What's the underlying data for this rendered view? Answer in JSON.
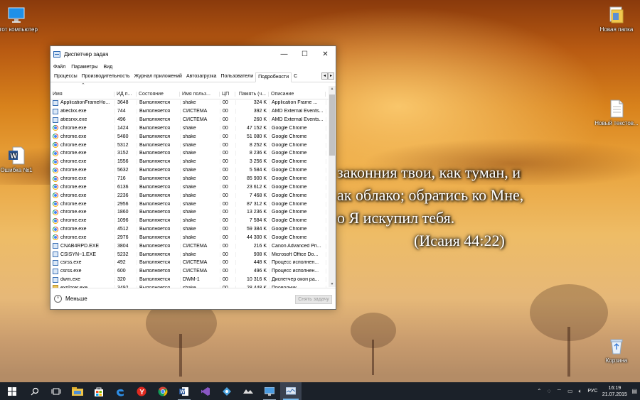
{
  "desktop": {
    "icons": [
      {
        "label": "Этот компьютер"
      },
      {
        "label": "Новая папка"
      },
      {
        "label": "Новый текстов..."
      },
      {
        "label": "Ошибка №1"
      },
      {
        "label": "Корзина"
      }
    ],
    "verse_lines": [
      "законния твои, как туман, и",
      "ак облако; обратись ко Мне,",
      "о Я искупил тебя.",
      "(Исаия 44:22)"
    ]
  },
  "task_manager": {
    "title": "Диспетчер задач",
    "window_buttons": {
      "minimize": "—",
      "maximize": "☐",
      "close": "✕"
    },
    "menu": [
      "Файл",
      "Параметры",
      "Вид"
    ],
    "tabs": [
      "Процессы",
      "Производительность",
      "Журнал приложений",
      "Автозагрузка",
      "Пользователи",
      "Подробности",
      "С"
    ],
    "active_tab": "Подробности",
    "columns": [
      "Имя",
      "ИД п...",
      "Состояние",
      "Имя польз...",
      "ЦП",
      "Память (ч...",
      "Описание"
    ],
    "rows": [
      {
        "icon": "exe",
        "name": "ApplicationFrameHo...",
        "pid": "3648",
        "status": "Выполняется",
        "user": "shake",
        "cpu": "00",
        "mem": "324 K",
        "desc": "Application Frame ..."
      },
      {
        "icon": "exe",
        "name": "atieclxx.exe",
        "pid": "744",
        "status": "Выполняется",
        "user": "СИСТЕМА",
        "cpu": "00",
        "mem": "392 K",
        "desc": "AMD External Events..."
      },
      {
        "icon": "exe",
        "name": "atiesrxx.exe",
        "pid": "496",
        "status": "Выполняется",
        "user": "СИСТЕМА",
        "cpu": "00",
        "mem": "260 K",
        "desc": "AMD External Events..."
      },
      {
        "icon": "chrome",
        "name": "chrome.exe",
        "pid": "1424",
        "status": "Выполняется",
        "user": "shake",
        "cpu": "00",
        "mem": "47 152 K",
        "desc": "Google Chrome"
      },
      {
        "icon": "chrome",
        "name": "chrome.exe",
        "pid": "5480",
        "status": "Выполняется",
        "user": "shake",
        "cpu": "00",
        "mem": "51 080 K",
        "desc": "Google Chrome"
      },
      {
        "icon": "chrome",
        "name": "chrome.exe",
        "pid": "5312",
        "status": "Выполняется",
        "user": "shake",
        "cpu": "00",
        "mem": "8 252 K",
        "desc": "Google Chrome"
      },
      {
        "icon": "chrome",
        "name": "chrome.exe",
        "pid": "3152",
        "status": "Выполняется",
        "user": "shake",
        "cpu": "00",
        "mem": "8 236 K",
        "desc": "Google Chrome"
      },
      {
        "icon": "chrome",
        "name": "chrome.exe",
        "pid": "1556",
        "status": "Выполняется",
        "user": "shake",
        "cpu": "00",
        "mem": "3 256 K",
        "desc": "Google Chrome"
      },
      {
        "icon": "chrome",
        "name": "chrome.exe",
        "pid": "5632",
        "status": "Выполняется",
        "user": "shake",
        "cpu": "00",
        "mem": "5 584 K",
        "desc": "Google Chrome"
      },
      {
        "icon": "chrome",
        "name": "chrome.exe",
        "pid": "716",
        "status": "Выполняется",
        "user": "shake",
        "cpu": "00",
        "mem": "85 900 K",
        "desc": "Google Chrome"
      },
      {
        "icon": "chrome",
        "name": "chrome.exe",
        "pid": "6136",
        "status": "Выполняется",
        "user": "shake",
        "cpu": "00",
        "mem": "23 612 K",
        "desc": "Google Chrome"
      },
      {
        "icon": "chrome",
        "name": "chrome.exe",
        "pid": "2236",
        "status": "Выполняется",
        "user": "shake",
        "cpu": "00",
        "mem": "7 468 K",
        "desc": "Google Chrome"
      },
      {
        "icon": "chrome",
        "name": "chrome.exe",
        "pid": "2956",
        "status": "Выполняется",
        "user": "shake",
        "cpu": "00",
        "mem": "87 312 K",
        "desc": "Google Chrome"
      },
      {
        "icon": "chrome",
        "name": "chrome.exe",
        "pid": "1860",
        "status": "Выполняется",
        "user": "shake",
        "cpu": "00",
        "mem": "13 236 K",
        "desc": "Google Chrome"
      },
      {
        "icon": "chrome",
        "name": "chrome.exe",
        "pid": "1096",
        "status": "Выполняется",
        "user": "shake",
        "cpu": "00",
        "mem": "7 584 K",
        "desc": "Google Chrome"
      },
      {
        "icon": "chrome",
        "name": "chrome.exe",
        "pid": "4512",
        "status": "Выполняется",
        "user": "shake",
        "cpu": "00",
        "mem": "59 384 K",
        "desc": "Google Chrome"
      },
      {
        "icon": "chrome",
        "name": "chrome.exe",
        "pid": "2976",
        "status": "Выполняется",
        "user": "shake",
        "cpu": "00",
        "mem": "44 300 K",
        "desc": "Google Chrome"
      },
      {
        "icon": "exe",
        "name": "CNAB4RPD.EXE",
        "pid": "3804",
        "status": "Выполняется",
        "user": "СИСТЕМА",
        "cpu": "00",
        "mem": "216 K",
        "desc": "Canon Advanced Pri..."
      },
      {
        "icon": "exe",
        "name": "CSISYN~1.EXE",
        "pid": "5232",
        "status": "Выполняется",
        "user": "shake",
        "cpu": "00",
        "mem": "908 K",
        "desc": "Microsoft Office Do..."
      },
      {
        "icon": "exe",
        "name": "csrss.exe",
        "pid": "492",
        "status": "Выполняется",
        "user": "СИСТЕМА",
        "cpu": "00",
        "mem": "448 K",
        "desc": "Процесс исполнен..."
      },
      {
        "icon": "exe",
        "name": "csrss.exe",
        "pid": "600",
        "status": "Выполняется",
        "user": "СИСТЕМА",
        "cpu": "00",
        "mem": "496 K",
        "desc": "Процесс исполнен..."
      },
      {
        "icon": "exe",
        "name": "dwm.exe",
        "pid": "320",
        "status": "Выполняется",
        "user": "DWM-1",
        "cpu": "00",
        "mem": "10 316 K",
        "desc": "Диспетчер окон ра..."
      },
      {
        "icon": "folder",
        "name": "explorer.exe",
        "pid": "3492",
        "status": "Выполняется",
        "user": "shake",
        "cpu": "00",
        "mem": "28 448 K",
        "desc": "Проводник"
      }
    ],
    "footer": {
      "less_label": "Меньше",
      "end_task_label": "Снять задачу"
    }
  },
  "taskbar": {
    "apps": [
      "windows-start",
      "search",
      "task-view",
      "file-explorer",
      "store",
      "edge",
      "yandex-browser",
      "chrome",
      "word",
      "visual-studio",
      "paint",
      "app-tray",
      "desktop",
      "task-manager"
    ],
    "tray": {
      "language": "РУС",
      "time": "16:19",
      "date": "21.07.2015"
    }
  }
}
